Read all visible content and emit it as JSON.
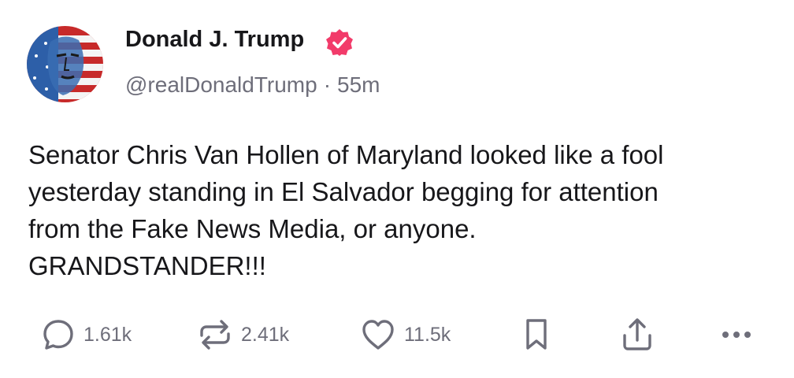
{
  "author": {
    "name": "Donald J. Trump",
    "handle": "@realDonaldTrump",
    "separator": "·",
    "time": "55m"
  },
  "post": {
    "lines": [
      "Senator Chris Van Hollen of Maryland looked like a fool",
      "yesterday standing in El Salvador begging for attention",
      "from the Fake News Media, or anyone.",
      "GRANDSTANDER!!!"
    ]
  },
  "actions": {
    "replies": "1.61k",
    "reposts": "2.41k",
    "likes": "11.5k"
  },
  "colors": {
    "text": "#17171a",
    "muted": "#6e6e7a",
    "verified": "#f23b6a"
  }
}
